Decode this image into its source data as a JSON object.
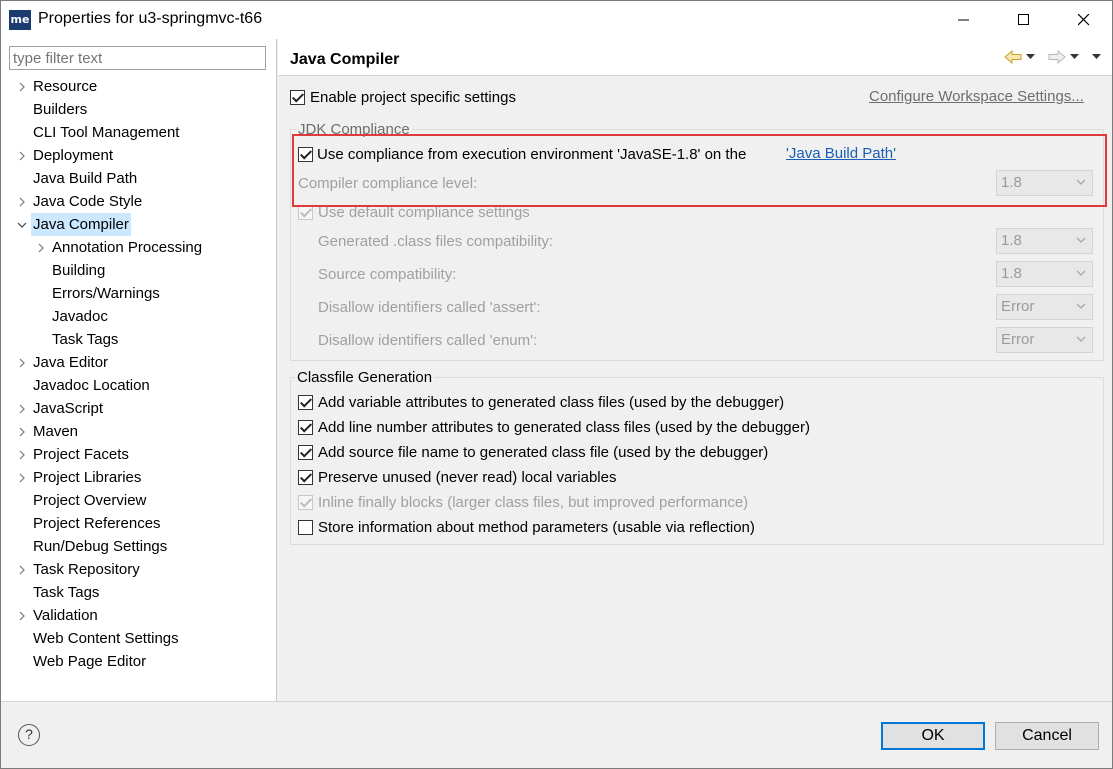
{
  "window": {
    "app_icon_text": "me",
    "title": "Properties for u3-springmvc-t66"
  },
  "filter": {
    "placeholder": "type filter text"
  },
  "tree": [
    {
      "label": "Resource",
      "expandable": true,
      "level": 0
    },
    {
      "label": "Builders",
      "expandable": false,
      "level": 0
    },
    {
      "label": "CLI Tool Management",
      "expandable": false,
      "level": 0
    },
    {
      "label": "Deployment",
      "expandable": true,
      "level": 0
    },
    {
      "label": "Java Build Path",
      "expandable": false,
      "level": 0
    },
    {
      "label": "Java Code Style",
      "expandable": true,
      "level": 0
    },
    {
      "label": "Java Compiler",
      "expandable": true,
      "expanded": true,
      "selected": true,
      "level": 0
    },
    {
      "label": "Annotation Processing",
      "expandable": true,
      "level": 1
    },
    {
      "label": "Building",
      "expandable": false,
      "level": 1
    },
    {
      "label": "Errors/Warnings",
      "expandable": false,
      "level": 1
    },
    {
      "label": "Javadoc",
      "expandable": false,
      "level": 1
    },
    {
      "label": "Task Tags",
      "expandable": false,
      "level": 1
    },
    {
      "label": "Java Editor",
      "expandable": true,
      "level": 0
    },
    {
      "label": "Javadoc Location",
      "expandable": false,
      "level": 0
    },
    {
      "label": "JavaScript",
      "expandable": true,
      "level": 0
    },
    {
      "label": "Maven",
      "expandable": true,
      "level": 0
    },
    {
      "label": "Project Facets",
      "expandable": true,
      "level": 0
    },
    {
      "label": "Project Libraries",
      "expandable": true,
      "level": 0
    },
    {
      "label": "Project Overview",
      "expandable": false,
      "level": 0
    },
    {
      "label": "Project References",
      "expandable": false,
      "level": 0
    },
    {
      "label": "Run/Debug Settings",
      "expandable": false,
      "level": 0
    },
    {
      "label": "Task Repository",
      "expandable": true,
      "level": 0
    },
    {
      "label": "Task Tags",
      "expandable": false,
      "level": 0
    },
    {
      "label": "Validation",
      "expandable": true,
      "level": 0
    },
    {
      "label": "Web Content Settings",
      "expandable": false,
      "level": 0
    },
    {
      "label": "Web Page Editor",
      "expandable": false,
      "level": 0
    }
  ],
  "page": {
    "title": "Java Compiler",
    "enable_specific": {
      "label": "Enable project specific settings",
      "checked": true
    },
    "configure_link": "Configure Workspace Settings...",
    "jdk": {
      "title": "JDK Compliance",
      "use_env": {
        "label": "Use compliance from execution environment 'JavaSE-1.8' on the ",
        "link": "'Java Build Path'",
        "checked": true
      },
      "compliance_level": {
        "label": "Compiler compliance level:",
        "value": "1.8"
      },
      "use_default": {
        "label": "Use default compliance settings",
        "checked": true
      },
      "generated": {
        "label": "Generated .class files compatibility:",
        "value": "1.8"
      },
      "source": {
        "label": "Source compatibility:",
        "value": "1.8"
      },
      "assert": {
        "label": "Disallow identifiers called 'assert':",
        "value": "Error"
      },
      "enum": {
        "label": "Disallow identifiers called 'enum':",
        "value": "Error"
      }
    },
    "classfile": {
      "title": "Classfile Generation",
      "options": [
        {
          "label": "Add variable attributes to generated class files (used by the debugger)",
          "checked": true,
          "disabled": false
        },
        {
          "label": "Add line number attributes to generated class files (used by the debugger)",
          "checked": true,
          "disabled": false
        },
        {
          "label": "Add source file name to generated class file (used by the debugger)",
          "checked": true,
          "disabled": false
        },
        {
          "label": "Preserve unused (never read) local variables",
          "checked": true,
          "disabled": false
        },
        {
          "label": "Inline finally blocks (larger class files, but improved performance)",
          "checked": true,
          "disabled": true
        },
        {
          "label": "Store information about method parameters (usable via reflection)",
          "checked": false,
          "disabled": false
        }
      ]
    }
  },
  "buttons": {
    "help": "?",
    "ok": "OK",
    "cancel": "Cancel"
  },
  "colors": {
    "link": "#1a5fb4",
    "selection": "#cce8ff",
    "highlight_border": "#e03a3a",
    "default_button_border": "#0078d7"
  }
}
